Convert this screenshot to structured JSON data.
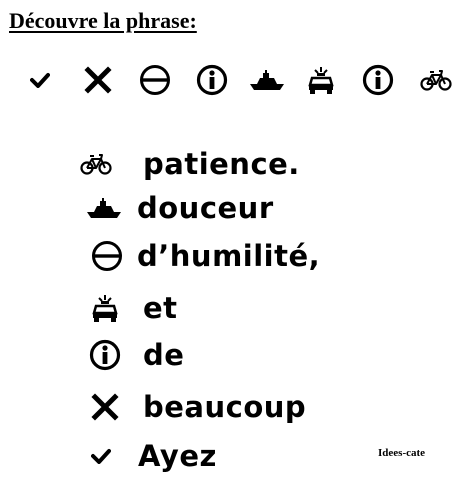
{
  "title": "Découvre la phrase:",
  "code_sequence": [
    "check-icon",
    "cross-icon",
    "circle-minus-icon",
    "info-circle-icon",
    "boat-icon",
    "police-car-icon",
    "info-circle-icon",
    "bicycle-icon"
  ],
  "legend": [
    {
      "icon": "bicycle-icon",
      "word": "patience."
    },
    {
      "icon": "boat-icon",
      "word": "douceur"
    },
    {
      "icon": "circle-minus-icon",
      "word": "d’humilité,"
    },
    {
      "icon": "police-car-icon",
      "word": "et"
    },
    {
      "icon": "info-circle-icon",
      "word": "de"
    },
    {
      "icon": "cross-icon",
      "word": "beaucoup"
    },
    {
      "icon": "check-icon",
      "word": "Ayez"
    }
  ],
  "credit": "Idees-cate"
}
